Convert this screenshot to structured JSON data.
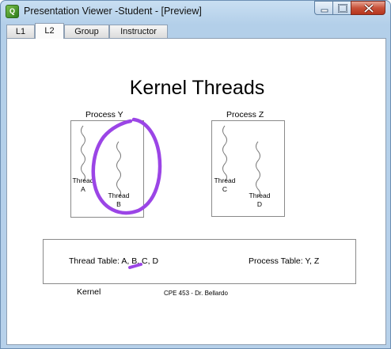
{
  "window": {
    "title": "Presentation Viewer -Student - [Preview]",
    "icon_name": "app-icon"
  },
  "tabs": [
    {
      "label": "L1",
      "active": false
    },
    {
      "label": "L2",
      "active": true
    },
    {
      "label": "Group",
      "active": false
    },
    {
      "label": "Instructor",
      "active": false
    }
  ],
  "slide": {
    "title": "Kernel Threads",
    "process_y": {
      "label": "Process Y",
      "thread_a": [
        "Thread",
        "A"
      ],
      "thread_b": [
        "Thread",
        "B"
      ]
    },
    "process_z": {
      "label": "Process Z",
      "thread_c": [
        "Thread",
        "C"
      ],
      "thread_d": [
        "Thread",
        "D"
      ]
    },
    "thread_table": "Thread Table: A, B, C, D",
    "process_table": "Process Table: Y, Z",
    "kernel_label": "Kernel",
    "footer": "CPE 453 - Dr. Bellardo"
  },
  "colors": {
    "annotation": "#9b45e6",
    "title_bar": "#b7d1ea",
    "close_button": "#c8523a"
  }
}
